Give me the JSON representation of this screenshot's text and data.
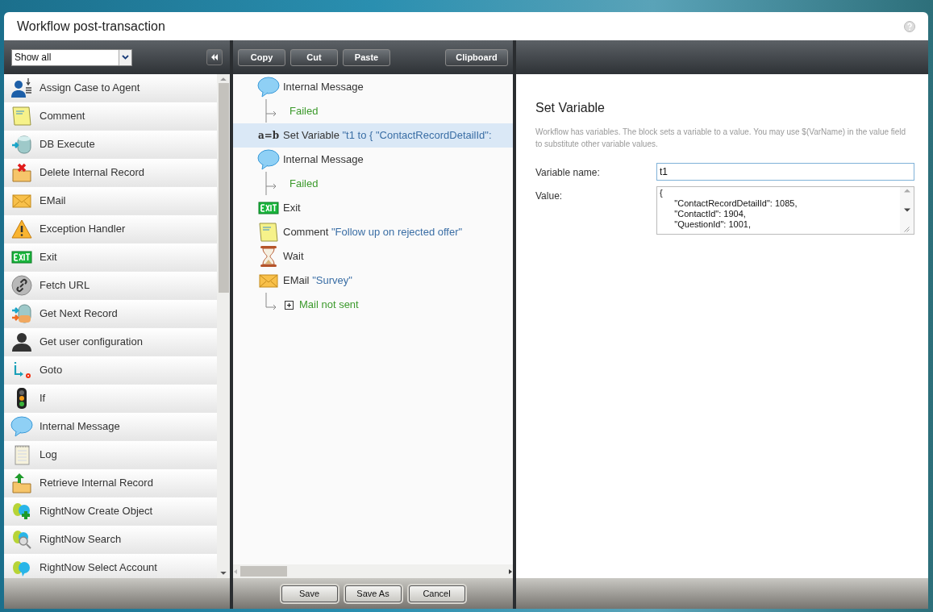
{
  "window": {
    "title": "Workflow post-transaction"
  },
  "palette": {
    "filter": "Show all",
    "items": [
      {
        "label": "Assign Case to Agent"
      },
      {
        "label": "Comment"
      },
      {
        "label": "DB Execute"
      },
      {
        "label": "Delete Internal Record"
      },
      {
        "label": "EMail"
      },
      {
        "label": "Exception Handler"
      },
      {
        "label": "Exit"
      },
      {
        "label": "Fetch URL"
      },
      {
        "label": "Get Next Record"
      },
      {
        "label": "Get user configuration"
      },
      {
        "label": "Goto"
      },
      {
        "label": "If"
      },
      {
        "label": "Internal Message"
      },
      {
        "label": "Log"
      },
      {
        "label": "Retrieve Internal Record"
      },
      {
        "label": "RightNow Create Object"
      },
      {
        "label": "RightNow Search"
      },
      {
        "label": "RightNow Select Account"
      }
    ]
  },
  "toolbar": [
    "Copy",
    "Cut",
    "Paste",
    "Clipboard"
  ],
  "flow": [
    {
      "kind": "message",
      "name": "Internal Message",
      "selected": false
    },
    {
      "kind": "outcome",
      "name": "Failed"
    },
    {
      "kind": "set-variable",
      "icon": "a=b",
      "name": "Set Variable",
      "detail": "\"t1 to { \"ContactRecordDetailId\":",
      "selected": true
    },
    {
      "kind": "message",
      "name": "Internal Message",
      "selected": false
    },
    {
      "kind": "outcome",
      "name": "Failed"
    },
    {
      "kind": "exit",
      "name": "Exit",
      "selected": false
    },
    {
      "kind": "comment",
      "name": "Comment",
      "detail": "\"Follow up on rejected offer\"",
      "selected": false
    },
    {
      "kind": "wait",
      "name": "Wait",
      "selected": false
    },
    {
      "kind": "email",
      "name": "EMail",
      "detail": "\"Survey\"",
      "selected": false
    },
    {
      "kind": "outcome",
      "name": "Mail not sent",
      "expanded": false
    }
  ],
  "bottom_buttons": [
    "Save",
    "Save As",
    "Cancel"
  ],
  "properties": {
    "title": "Set Variable",
    "description": "Workflow has variables. The block sets a variable to a value. You may use $(VarName) in the value field to substitute other variable values.",
    "fields": [
      {
        "label": "Variable name:",
        "value": "t1"
      },
      {
        "label": "Value:",
        "value": "{\n      \"ContactRecordDetailId\": 1085,\n      \"ContactId\": 1904,\n      \"QuestionId\": 1001,"
      }
    ]
  }
}
